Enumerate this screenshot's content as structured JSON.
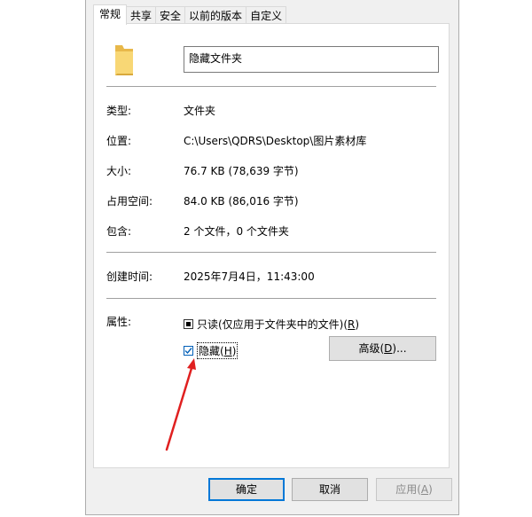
{
  "tabs": [
    {
      "label": "常规",
      "active": true
    },
    {
      "label": "共享"
    },
    {
      "label": "安全"
    },
    {
      "label": "以前的版本"
    },
    {
      "label": "自定义"
    }
  ],
  "folder_name": "隐藏文件夹",
  "properties": {
    "type_label": "类型:",
    "type_value": "文件夹",
    "location_label": "位置:",
    "location_value": "C:\\Users\\QDRS\\Desktop\\图片素材库",
    "size_label": "大小:",
    "size_value": "76.7 KB (78,639 字节)",
    "disk_label": "占用空间:",
    "disk_value": "84.0 KB (86,016 字节)",
    "contains_label": "包含:",
    "contains_value": "2 个文件，0 个文件夹",
    "created_label": "创建时间:",
    "created_value": "2025年7月4日，11:43:00"
  },
  "attributes": {
    "label": "属性:",
    "readonly_label": "只读(仅应用于文件夹中的文件)(",
    "readonly_key": "R",
    "readonly_state": "indeterminate",
    "hidden_label": "隐藏(",
    "hidden_key": "H",
    "hidden_checked": true,
    "advanced_label": "高级(",
    "advanced_key": "D",
    "advanced_suffix": ")..."
  },
  "buttons": {
    "ok": "确定",
    "cancel": "取消",
    "apply_label": "应用(",
    "apply_key": "A"
  },
  "colors": {
    "accent": "#0078d7",
    "arrow": "#e02020",
    "folder": "#f8d775"
  }
}
